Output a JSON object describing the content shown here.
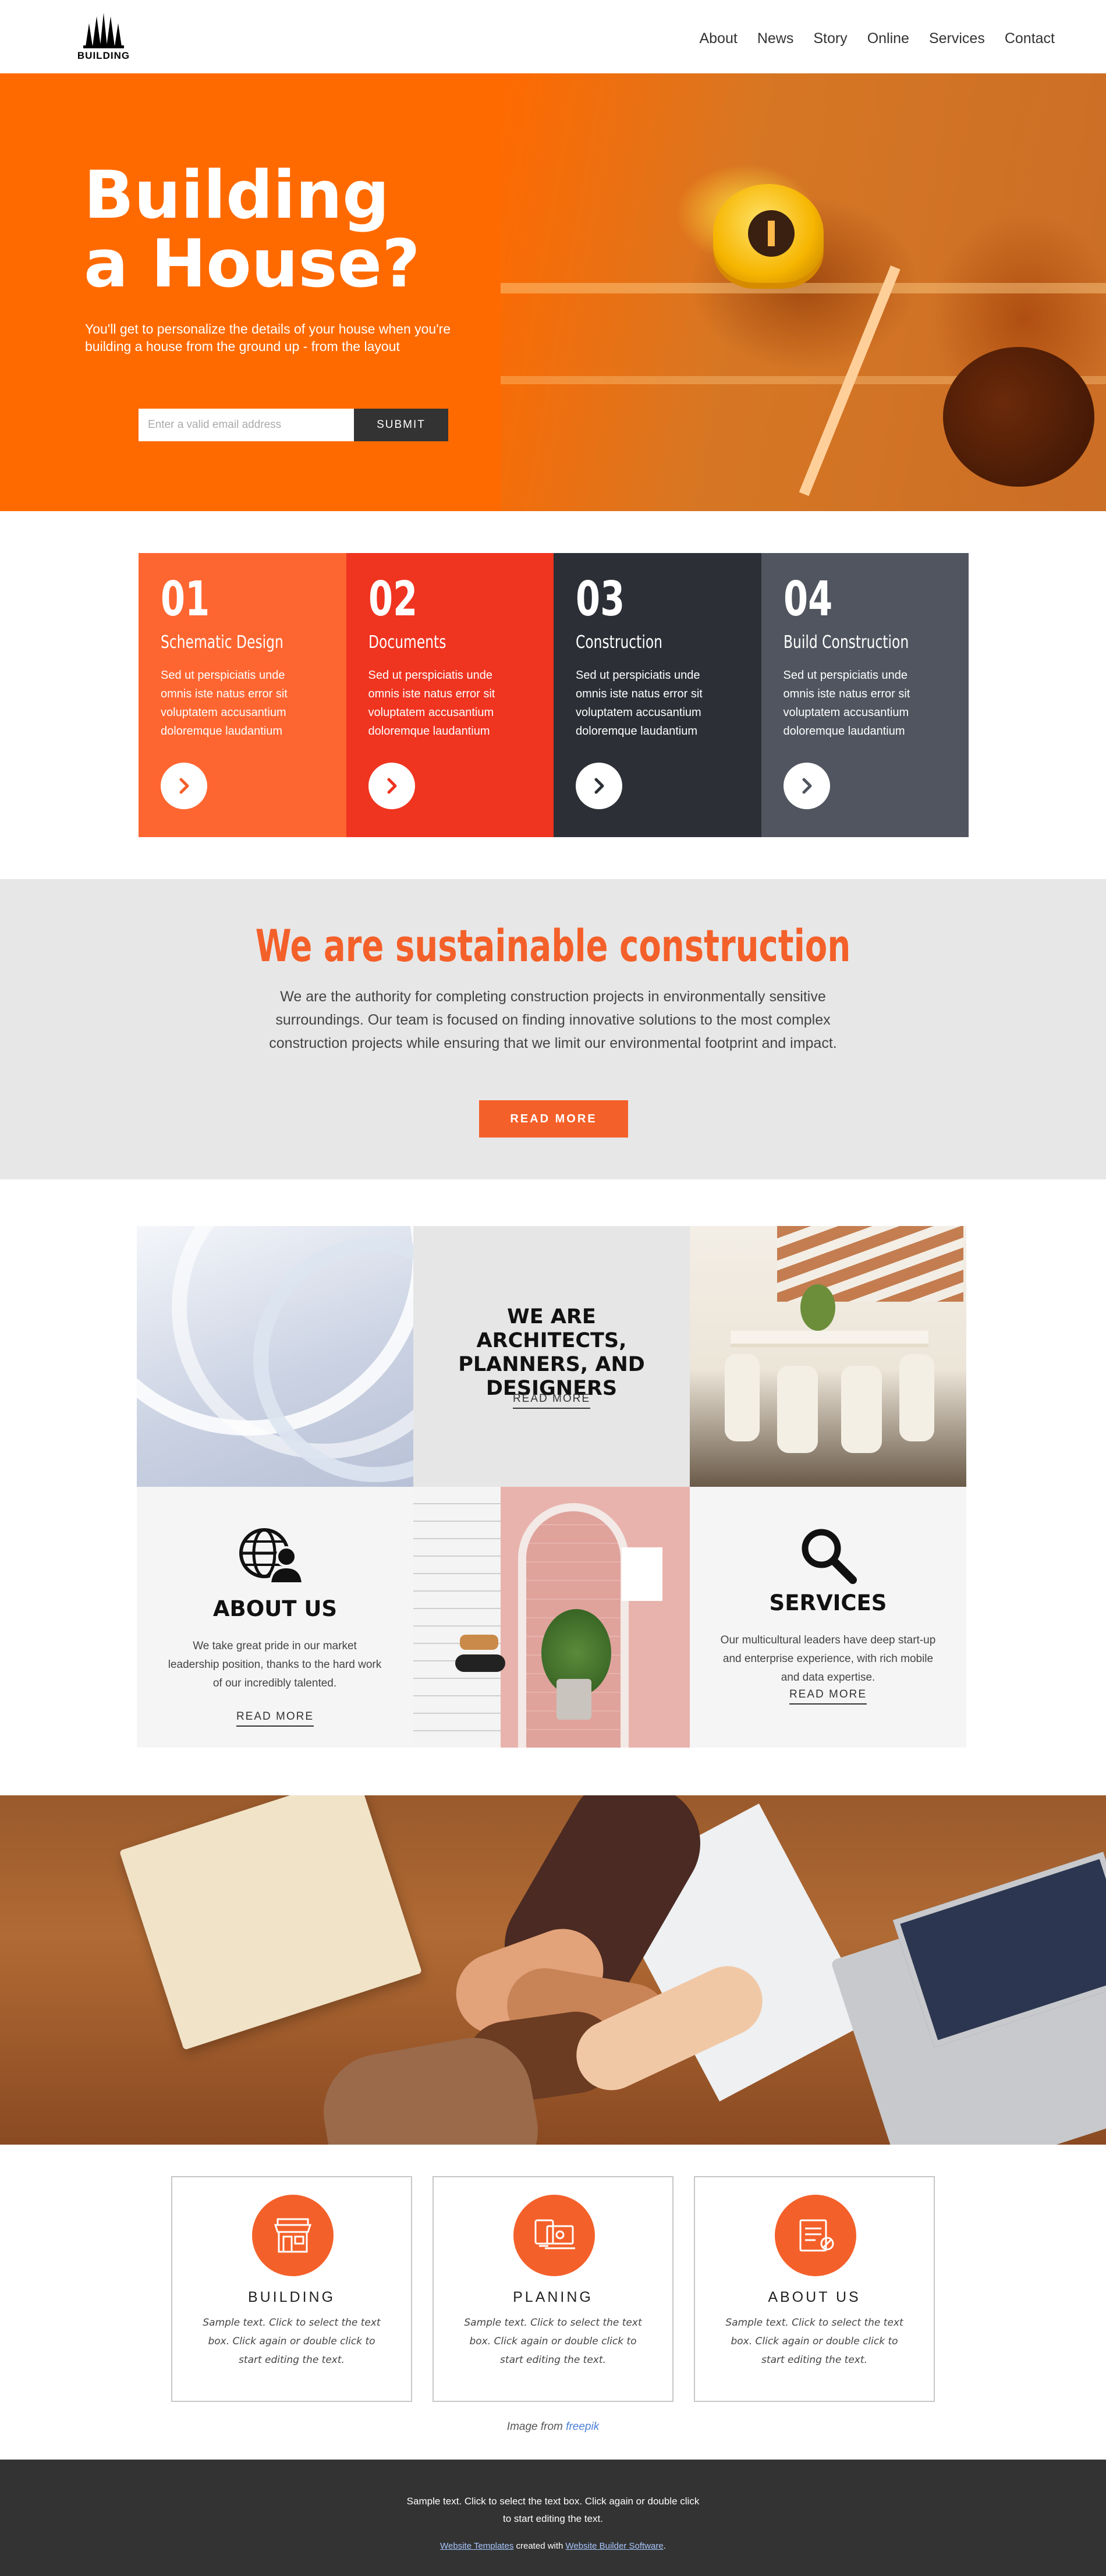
{
  "brand": {
    "logo_text": "BUILDING"
  },
  "nav": [
    "About",
    "News",
    "Story",
    "Online",
    "Services",
    "Contact"
  ],
  "hero": {
    "title_line1": "Building",
    "title_line2": "a House?",
    "subtitle": "You'll get to personalize the details of your house when you're building a house from the ground up - from the layout",
    "email_placeholder": "Enter a valid email address",
    "submit_label": "SUBMIT"
  },
  "steps": [
    {
      "num": "01",
      "title": "Schematic Design",
      "text": "Sed ut perspiciatis unde omnis iste natus error sit voluptatem accusantium doloremque laudantium",
      "color": "#fe6631",
      "arrow_color": "#f4602a"
    },
    {
      "num": "02",
      "title": "Documents",
      "text": "Sed ut perspiciatis unde omnis iste natus error sit voluptatem accusantium doloremque laudantium",
      "color": "#ef3420",
      "arrow_color": "#ef3420"
    },
    {
      "num": "03",
      "title": "Construction",
      "text": "Sed ut perspiciatis unde omnis iste natus error sit voluptatem accusantium doloremque laudantium",
      "color": "#2c2f36",
      "arrow_color": "#2c2f36"
    },
    {
      "num": "04",
      "title": "Build Construction",
      "text": "Sed ut perspiciatis unde omnis iste natus error sit voluptatem accusantium doloremque laudantium",
      "color": "#50555f",
      "arrow_color": "#50555f"
    }
  ],
  "sustainable": {
    "title": "We are sustainable construction",
    "text": "We are the authority for completing construction projects in environmentally sensitive surroundings. Our team is focused on finding innovative solutions to the most complex construction projects while ensuring that we limit our environmental footprint and impact.",
    "button": "READ MORE"
  },
  "grid": {
    "architects_title": "WE ARE ARCHITECTS, PLANNERS, AND DESIGNERS",
    "architects_link": "READ MORE",
    "about_title": "ABOUT US",
    "about_text": "We take great pride in our market leadership position, thanks to the hard work of our incredibly talented.",
    "about_link": "READ MORE",
    "services_title": "SERVICES",
    "services_text": "Our multicultural leaders have deep start-up and enterprise experience, with rich mobile and data expertise.",
    "services_link": "READ MORE"
  },
  "features": [
    {
      "title": "BUILDING",
      "text": "Sample text. Click to select the text box. Click again or double click to start editing the text.",
      "icon": "storefront-icon"
    },
    {
      "title": "PLANING",
      "text": "Sample text. Click to select the text box. Click again or double click to start editing the text.",
      "icon": "devices-icon"
    },
    {
      "title": "ABOUT US",
      "text": "Sample text. Click to select the text box. Click again or double click to start editing the text.",
      "icon": "document-icon"
    }
  ],
  "credit": {
    "prefix": "Image from",
    "link": "freepik"
  },
  "footer": {
    "text": "Sample text. Click to select the text box. Click again or double click to start editing the text.",
    "link1": "Website Templates",
    "middle": "created with",
    "link2": "Website Builder Software",
    "suffix": "."
  },
  "colors": {
    "accent": "#f4602a",
    "hero_bg": "#ff6a00",
    "dark": "#333333"
  }
}
